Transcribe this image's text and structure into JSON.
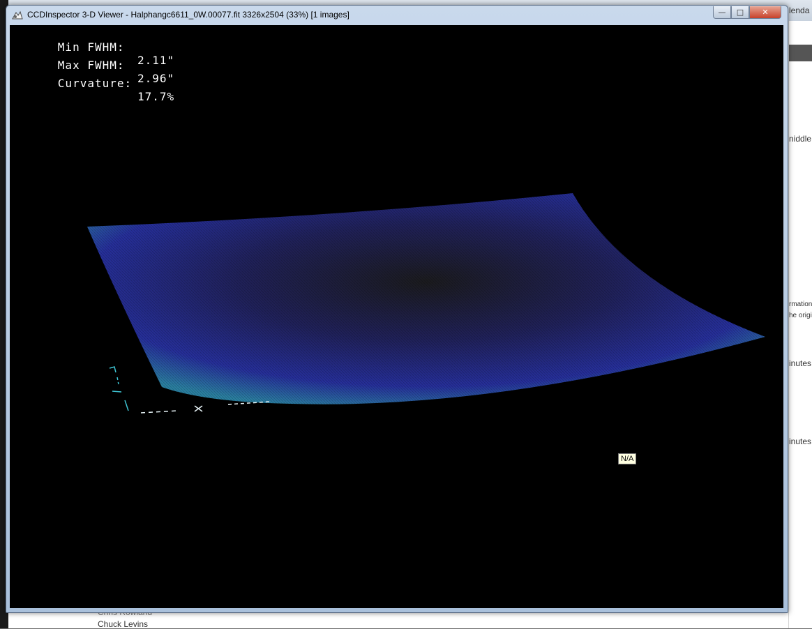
{
  "window": {
    "title": "CCDInspector 3-D Viewer - Halphangc6611_0W.00077.fit 3326x2504 (33%)  [1 images]",
    "minimize_glyph": "—",
    "maximize_glyph": "□",
    "close_glyph": "✕"
  },
  "stats": {
    "min_fwhm_label": "Min FWHM:",
    "min_fwhm_value": "2.11\"",
    "max_fwhm_label": "Max FWHM:",
    "max_fwhm_value": "2.96\"",
    "curvature_label": "Curvature:",
    "curvature_value": "17.7%"
  },
  "surface": {
    "icon": "3d-fwhm-surface",
    "colors": {
      "edge": "#2a7fa0",
      "mid": "#262f9a",
      "center": "#1b1b1e"
    },
    "axis_color": "#3fc7d6"
  },
  "tooltip": {
    "text": "N/A"
  },
  "background": {
    "right_texts": [
      "lenda",
      "niddle",
      "rmation",
      "he origi",
      "inutes",
      "inutes"
    ],
    "bottom_texts": [
      "Chris Rowland",
      "Chuck Levins"
    ]
  }
}
